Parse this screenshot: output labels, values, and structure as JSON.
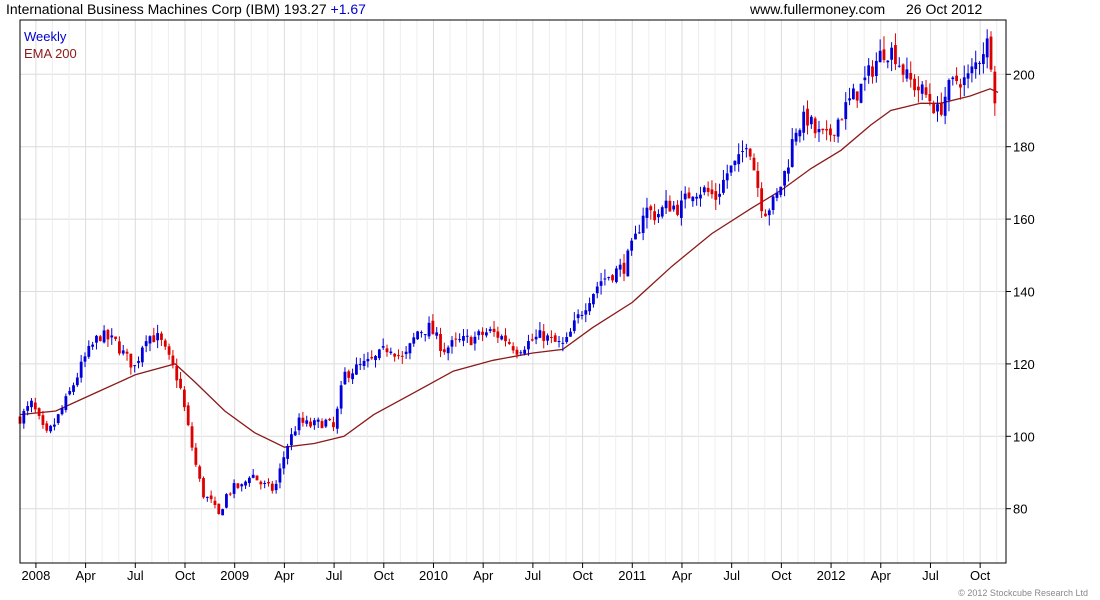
{
  "header": {
    "title": "International Business Machines Corp (IBM)",
    "price": "193.27",
    "change": "+1.67",
    "website": "www.fullermoney.com",
    "date": "26 Oct 2012"
  },
  "legend": {
    "weekly_label": "Weekly",
    "ema_label": "EMA 200"
  },
  "footer": {
    "copyright": "© 2012 Stockcube Research Ltd"
  },
  "colors": {
    "up": "#0000dd",
    "down": "#dd0000",
    "ema": "#8b1a1a",
    "grid": "#dcdcdc",
    "change_text": "#0000cc",
    "legend_weekly": "#0000cc",
    "legend_ema": "#8b1a1a"
  },
  "chart_data": {
    "type": "candlestick",
    "title": "International Business Machines Corp (IBM)",
    "frequency": "Weekly",
    "ylim": [
      65,
      215
    ],
    "y_ticks": [
      80,
      100,
      120,
      140,
      160,
      180,
      200
    ],
    "x_tick_labels": [
      "2008",
      "Apr",
      "Jul",
      "Oct",
      "2009",
      "Apr",
      "Jul",
      "Oct",
      "2010",
      "Apr",
      "Jul",
      "Oct",
      "2011",
      "Apr",
      "Jul",
      "Oct",
      "2012",
      "Apr",
      "Jul",
      "Oct"
    ],
    "x_range": [
      2007.92,
      2012.88
    ],
    "close_path": [
      [
        2007.92,
        105
      ],
      [
        2007.98,
        109
      ],
      [
        2008.05,
        100
      ],
      [
        2008.1,
        104
      ],
      [
        2008.17,
        112
      ],
      [
        2008.25,
        122
      ],
      [
        2008.32,
        128
      ],
      [
        2008.4,
        126
      ],
      [
        2008.45,
        122
      ],
      [
        2008.5,
        119
      ],
      [
        2008.55,
        128
      ],
      [
        2008.62,
        127
      ],
      [
        2008.68,
        120
      ],
      [
        2008.72,
        115
      ],
      [
        2008.76,
        104
      ],
      [
        2008.8,
        93
      ],
      [
        2008.84,
        84
      ],
      [
        2008.88,
        82
      ],
      [
        2008.92,
        78
      ],
      [
        2008.96,
        84
      ],
      [
        2009.0,
        86
      ],
      [
        2009.04,
        86
      ],
      [
        2009.08,
        90
      ],
      [
        2009.13,
        87
      ],
      [
        2009.2,
        85
      ],
      [
        2009.26,
        97
      ],
      [
        2009.32,
        104
      ],
      [
        2009.38,
        103
      ],
      [
        2009.46,
        104
      ],
      [
        2009.5,
        102
      ],
      [
        2009.55,
        117
      ],
      [
        2009.62,
        119
      ],
      [
        2009.7,
        121
      ],
      [
        2009.78,
        125
      ],
      [
        2009.85,
        121
      ],
      [
        2009.92,
        129
      ],
      [
        2009.98,
        130
      ],
      [
        2010.05,
        124
      ],
      [
        2010.12,
        126
      ],
      [
        2010.2,
        127
      ],
      [
        2010.28,
        129
      ],
      [
        2010.36,
        127
      ],
      [
        2010.42,
        124
      ],
      [
        2010.48,
        126
      ],
      [
        2010.55,
        128
      ],
      [
        2010.6,
        126
      ],
      [
        2010.66,
        125
      ],
      [
        2010.72,
        132
      ],
      [
        2010.78,
        138
      ],
      [
        2010.84,
        143
      ],
      [
        2010.9,
        145
      ],
      [
        2010.96,
        147
      ],
      [
        2011.02,
        155
      ],
      [
        2011.06,
        163
      ],
      [
        2011.12,
        161
      ],
      [
        2011.18,
        164
      ],
      [
        2011.24,
        163
      ],
      [
        2011.3,
        168
      ],
      [
        2011.36,
        168
      ],
      [
        2011.42,
        166
      ],
      [
        2011.48,
        173
      ],
      [
        2011.54,
        176
      ],
      [
        2011.58,
        183
      ],
      [
        2011.62,
        172
      ],
      [
        2011.66,
        162
      ],
      [
        2011.72,
        165
      ],
      [
        2011.78,
        175
      ],
      [
        2011.82,
        185
      ],
      [
        2011.88,
        188
      ],
      [
        2011.92,
        184
      ],
      [
        2011.98,
        182
      ],
      [
        2012.04,
        188
      ],
      [
        2012.1,
        193
      ],
      [
        2012.16,
        197
      ],
      [
        2012.22,
        203
      ],
      [
        2012.27,
        207
      ],
      [
        2012.32,
        206
      ],
      [
        2012.38,
        199
      ],
      [
        2012.44,
        196
      ],
      [
        2012.5,
        193
      ],
      [
        2012.54,
        189
      ],
      [
        2012.58,
        195
      ],
      [
        2012.64,
        199
      ],
      [
        2012.68,
        198
      ],
      [
        2012.74,
        204
      ],
      [
        2012.78,
        209
      ],
      [
        2012.8,
        207
      ],
      [
        2012.82,
        195
      ],
      [
        2012.84,
        193.27
      ]
    ],
    "ema_200": [
      [
        2007.92,
        106
      ],
      [
        2008.1,
        107
      ],
      [
        2008.3,
        112
      ],
      [
        2008.5,
        117
      ],
      [
        2008.7,
        120
      ],
      [
        2008.8,
        115
      ],
      [
        2008.95,
        107
      ],
      [
        2009.1,
        101
      ],
      [
        2009.25,
        97
      ],
      [
        2009.4,
        98
      ],
      [
        2009.55,
        100
      ],
      [
        2009.7,
        106
      ],
      [
        2009.9,
        112
      ],
      [
        2010.1,
        118
      ],
      [
        2010.3,
        121
      ],
      [
        2010.5,
        123
      ],
      [
        2010.65,
        124
      ],
      [
        2010.8,
        130
      ],
      [
        2011.0,
        137
      ],
      [
        2011.2,
        147
      ],
      [
        2011.4,
        156
      ],
      [
        2011.6,
        163
      ],
      [
        2011.75,
        168
      ],
      [
        2011.9,
        174
      ],
      [
        2012.05,
        179
      ],
      [
        2012.2,
        186
      ],
      [
        2012.3,
        190
      ],
      [
        2012.45,
        192
      ],
      [
        2012.55,
        192
      ],
      [
        2012.7,
        194
      ],
      [
        2012.8,
        196
      ],
      [
        2012.84,
        195
      ]
    ]
  }
}
